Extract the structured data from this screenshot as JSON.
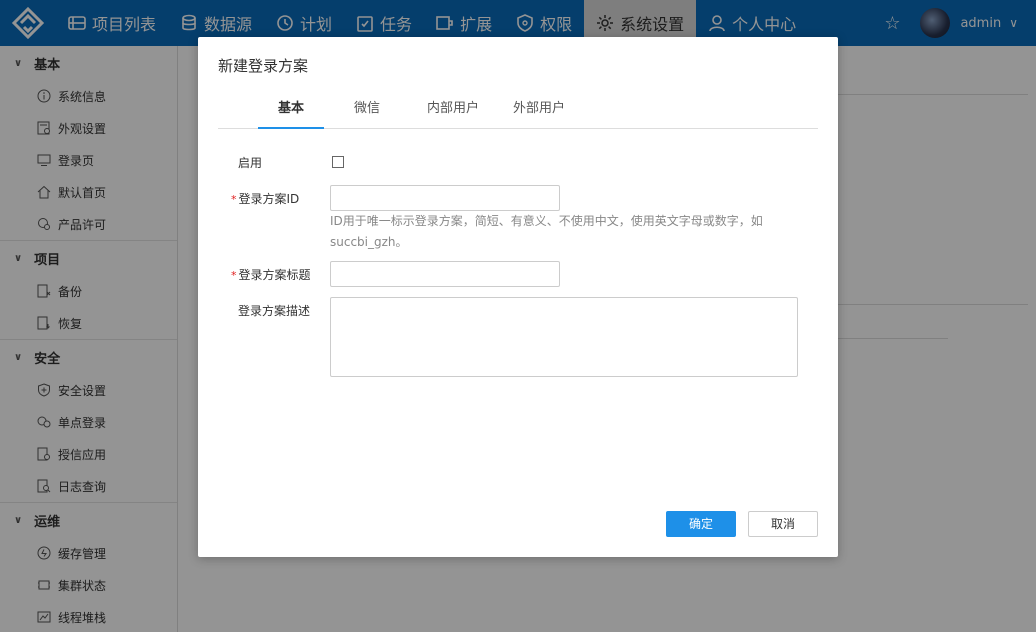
{
  "nav": {
    "items": [
      {
        "label": "项目列表",
        "icon": "project-list-icon"
      },
      {
        "label": "数据源",
        "icon": "database-icon"
      },
      {
        "label": "计划",
        "icon": "clock-icon"
      },
      {
        "label": "任务",
        "icon": "task-icon"
      },
      {
        "label": "扩展",
        "icon": "extension-icon"
      },
      {
        "label": "权限",
        "icon": "shield-icon"
      },
      {
        "label": "系统设置",
        "icon": "gear-icon"
      },
      {
        "label": "个人中心",
        "icon": "user-icon"
      }
    ],
    "active_index": 6,
    "username": "admin"
  },
  "sidebar": {
    "groups": [
      {
        "title": "基本",
        "items": [
          "系统信息",
          "外观设置",
          "登录页",
          "默认首页",
          "产品许可"
        ]
      },
      {
        "title": "项目",
        "items": [
          "备份",
          "恢复"
        ]
      },
      {
        "title": "安全",
        "items": [
          "安全设置",
          "单点登录",
          "授信应用",
          "日志查询"
        ]
      },
      {
        "title": "运维",
        "items": [
          "缓存管理",
          "集群状态",
          "线程堆栈"
        ]
      }
    ]
  },
  "modal": {
    "title": "新建登录方案",
    "tabs": [
      "基本",
      "微信",
      "内部用户",
      "外部用户"
    ],
    "active_tab": 0,
    "fields": {
      "enable_label": "启用",
      "enable_checked": false,
      "id_label": "登录方案ID",
      "id_value": "",
      "id_hint": "ID用于唯一标示登录方案，简短、有意义、不使用中文，使用英文字母或数字，如succbi_gzh。",
      "title_label": "登录方案标题",
      "title_value": "",
      "desc_label": "登录方案描述",
      "desc_value": "",
      "required_mark": "*"
    },
    "buttons": {
      "confirm": "确定",
      "cancel": "取消"
    }
  },
  "colors": {
    "topbar": "#0a6cbb",
    "primary": "#1e90e8",
    "required": "#e02020"
  }
}
